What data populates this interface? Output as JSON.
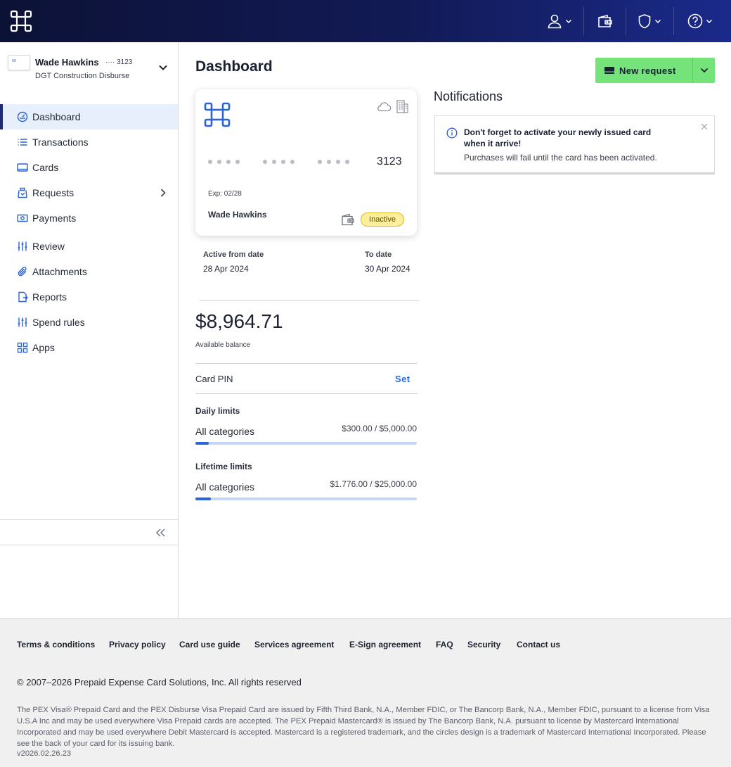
{
  "colors": {
    "topbar": "#0c1236",
    "accent": "#2b63d8",
    "primary_button": "#74e37a",
    "nav_active": "#e7eefc",
    "badge_inactive": "#fdee9c"
  },
  "header": {
    "icons": [
      "app-logo-icon",
      "user-icon",
      "wallet-icon",
      "shield-icon",
      "help-icon"
    ]
  },
  "account": {
    "name": "Wade Hawkins",
    "card_mask": "···· 3123",
    "subtitle": "DGT Construction Disburse"
  },
  "sidebar": {
    "items": [
      {
        "label": "Dashboard",
        "icon": "gauge-icon",
        "active": true
      },
      {
        "label": "Transactions",
        "icon": "list-icon"
      },
      {
        "label": "Cards",
        "icon": "card-icon"
      },
      {
        "label": "Requests",
        "icon": "requests-icon",
        "has_children": true
      },
      {
        "label": "Payments",
        "icon": "money-icon"
      },
      {
        "label": "Review",
        "icon": "sliders-icon"
      },
      {
        "label": "Attachments",
        "icon": "paperclip-icon"
      },
      {
        "label": "Reports",
        "icon": "report-icon"
      },
      {
        "label": "Spend rules",
        "icon": "sliders-icon"
      },
      {
        "label": "Apps",
        "icon": "grid-icon"
      }
    ]
  },
  "main": {
    "title": "Dashboard",
    "new_request_label": "New request",
    "card": {
      "last4": "3123",
      "expiry": "Exp: 02/28",
      "holder": "Wade Hawkins",
      "status": "Inactive"
    },
    "active_from_label": "Active from date",
    "active_from": "28 Apr 2024",
    "to_date_label": "To date",
    "to_date": "30 Apr 2024",
    "balance": "$8,964.71",
    "balance_label": "Available balance",
    "pin_label": "Card PIN",
    "pin_action": "Set",
    "daily_limits": {
      "title": "Daily limits",
      "category": "All categories",
      "amount": "$300.00 / $5,000.00",
      "fraction": 0.06
    },
    "lifetime_limits": {
      "title": "Lifetime limits",
      "category": "All categories",
      "amount": "$1.776.00 / $25,000.00",
      "fraction": 0.071
    }
  },
  "notifications": {
    "title": "Notifications",
    "items": [
      {
        "title": "Don't forget to activate your newly issued card when it arrive!",
        "body": "Purchases will fail until the card has been activated."
      }
    ]
  },
  "footer": {
    "links": [
      "Terms & conditions",
      "Privacy policy",
      "Card use guide",
      "Services agreement",
      "E-Sign agreement",
      "FAQ",
      "Security",
      "Contact us"
    ],
    "copyright": "© 2007–2026 Prepaid Expense Card Solutions, Inc. All rights reserved",
    "legal": "The PEX Visa® Prepaid Card and the PEX Disburse Visa Prepaid Card are issued by Fifth Third Bank, N.A., Member FDIC, or The Bancorp Bank, N.A., Member FDIC, pursuant to a license from Visa U.S.A Inc and may be used everywhere Visa Prepaid cards are accepted. The PEX Prepaid Mastercard® is issued by The Bancorp Bank, N.A. pursuant to license by Mastercard International Incorporated and may be used everywhere Debit Mastercard is accepted. Mastercard is a registered trademark, and the circles design is a trademark of Mastercard International Incorporated. Please see the back of your card for its issuing bank.",
    "version": "v2026.02.26.23"
  }
}
